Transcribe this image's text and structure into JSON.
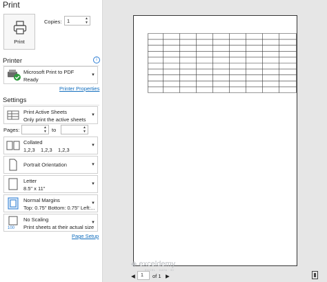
{
  "header": {
    "title": "Print"
  },
  "print_button": {
    "label": "Print"
  },
  "copies": {
    "label": "Copies:",
    "value": "1"
  },
  "printer": {
    "section_title": "Printer",
    "name": "Microsoft Print to PDF",
    "status": "Ready",
    "properties_link": "Printer Properties"
  },
  "settings": {
    "section_title": "Settings",
    "what_to_print": {
      "line1": "Print Active Sheets",
      "line2": "Only print the active sheets"
    },
    "pages": {
      "label": "Pages:",
      "to_label": "to",
      "from": "",
      "to": ""
    },
    "collation": {
      "line1": "Collated",
      "line2": "1,2,3    1,2,3    1,2,3"
    },
    "orientation": {
      "line1": "Portrait Orientation"
    },
    "paper": {
      "line1": "Letter",
      "line2": "8.5\" x 11\""
    },
    "margins": {
      "line1": "Normal Margins",
      "line2": "Top: 0.75\" Bottom: 0.75\" Left:..."
    },
    "scaling": {
      "line1": "No Scaling",
      "line2": "Print sheets at their actual size",
      "icon_text": "100"
    },
    "page_setup_link": "Page Setup"
  },
  "preview": {
    "current_page": "1",
    "page_total": "of 1",
    "grid_rows": 10,
    "grid_cols": 9
  },
  "watermark": {
    "text": "exceldemy",
    "sub": "EXCEL · DATA · BI"
  },
  "colors": {
    "link": "#0f6cbd",
    "accent": "#2b7cd3"
  }
}
